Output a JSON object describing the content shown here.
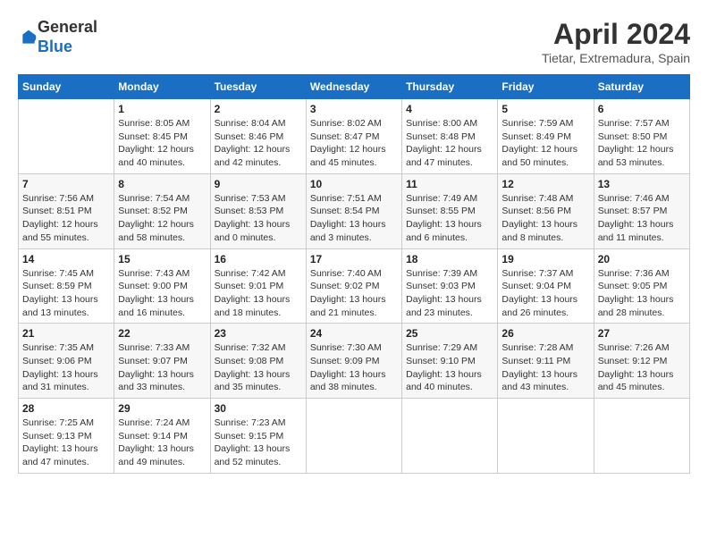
{
  "logo": {
    "general": "General",
    "blue": "Blue"
  },
  "title": "April 2024",
  "location": "Tietar, Extremadura, Spain",
  "days_header": [
    "Sunday",
    "Monday",
    "Tuesday",
    "Wednesday",
    "Thursday",
    "Friday",
    "Saturday"
  ],
  "weeks": [
    [
      {
        "day": "",
        "sunrise": "",
        "sunset": "",
        "daylight": ""
      },
      {
        "day": "1",
        "sunrise": "Sunrise: 8:05 AM",
        "sunset": "Sunset: 8:45 PM",
        "daylight": "Daylight: 12 hours and 40 minutes."
      },
      {
        "day": "2",
        "sunrise": "Sunrise: 8:04 AM",
        "sunset": "Sunset: 8:46 PM",
        "daylight": "Daylight: 12 hours and 42 minutes."
      },
      {
        "day": "3",
        "sunrise": "Sunrise: 8:02 AM",
        "sunset": "Sunset: 8:47 PM",
        "daylight": "Daylight: 12 hours and 45 minutes."
      },
      {
        "day": "4",
        "sunrise": "Sunrise: 8:00 AM",
        "sunset": "Sunset: 8:48 PM",
        "daylight": "Daylight: 12 hours and 47 minutes."
      },
      {
        "day": "5",
        "sunrise": "Sunrise: 7:59 AM",
        "sunset": "Sunset: 8:49 PM",
        "daylight": "Daylight: 12 hours and 50 minutes."
      },
      {
        "day": "6",
        "sunrise": "Sunrise: 7:57 AM",
        "sunset": "Sunset: 8:50 PM",
        "daylight": "Daylight: 12 hours and 53 minutes."
      }
    ],
    [
      {
        "day": "7",
        "sunrise": "Sunrise: 7:56 AM",
        "sunset": "Sunset: 8:51 PM",
        "daylight": "Daylight: 12 hours and 55 minutes."
      },
      {
        "day": "8",
        "sunrise": "Sunrise: 7:54 AM",
        "sunset": "Sunset: 8:52 PM",
        "daylight": "Daylight: 12 hours and 58 minutes."
      },
      {
        "day": "9",
        "sunrise": "Sunrise: 7:53 AM",
        "sunset": "Sunset: 8:53 PM",
        "daylight": "Daylight: 13 hours and 0 minutes."
      },
      {
        "day": "10",
        "sunrise": "Sunrise: 7:51 AM",
        "sunset": "Sunset: 8:54 PM",
        "daylight": "Daylight: 13 hours and 3 minutes."
      },
      {
        "day": "11",
        "sunrise": "Sunrise: 7:49 AM",
        "sunset": "Sunset: 8:55 PM",
        "daylight": "Daylight: 13 hours and 6 minutes."
      },
      {
        "day": "12",
        "sunrise": "Sunrise: 7:48 AM",
        "sunset": "Sunset: 8:56 PM",
        "daylight": "Daylight: 13 hours and 8 minutes."
      },
      {
        "day": "13",
        "sunrise": "Sunrise: 7:46 AM",
        "sunset": "Sunset: 8:57 PM",
        "daylight": "Daylight: 13 hours and 11 minutes."
      }
    ],
    [
      {
        "day": "14",
        "sunrise": "Sunrise: 7:45 AM",
        "sunset": "Sunset: 8:59 PM",
        "daylight": "Daylight: 13 hours and 13 minutes."
      },
      {
        "day": "15",
        "sunrise": "Sunrise: 7:43 AM",
        "sunset": "Sunset: 9:00 PM",
        "daylight": "Daylight: 13 hours and 16 minutes."
      },
      {
        "day": "16",
        "sunrise": "Sunrise: 7:42 AM",
        "sunset": "Sunset: 9:01 PM",
        "daylight": "Daylight: 13 hours and 18 minutes."
      },
      {
        "day": "17",
        "sunrise": "Sunrise: 7:40 AM",
        "sunset": "Sunset: 9:02 PM",
        "daylight": "Daylight: 13 hours and 21 minutes."
      },
      {
        "day": "18",
        "sunrise": "Sunrise: 7:39 AM",
        "sunset": "Sunset: 9:03 PM",
        "daylight": "Daylight: 13 hours and 23 minutes."
      },
      {
        "day": "19",
        "sunrise": "Sunrise: 7:37 AM",
        "sunset": "Sunset: 9:04 PM",
        "daylight": "Daylight: 13 hours and 26 minutes."
      },
      {
        "day": "20",
        "sunrise": "Sunrise: 7:36 AM",
        "sunset": "Sunset: 9:05 PM",
        "daylight": "Daylight: 13 hours and 28 minutes."
      }
    ],
    [
      {
        "day": "21",
        "sunrise": "Sunrise: 7:35 AM",
        "sunset": "Sunset: 9:06 PM",
        "daylight": "Daylight: 13 hours and 31 minutes."
      },
      {
        "day": "22",
        "sunrise": "Sunrise: 7:33 AM",
        "sunset": "Sunset: 9:07 PM",
        "daylight": "Daylight: 13 hours and 33 minutes."
      },
      {
        "day": "23",
        "sunrise": "Sunrise: 7:32 AM",
        "sunset": "Sunset: 9:08 PM",
        "daylight": "Daylight: 13 hours and 35 minutes."
      },
      {
        "day": "24",
        "sunrise": "Sunrise: 7:30 AM",
        "sunset": "Sunset: 9:09 PM",
        "daylight": "Daylight: 13 hours and 38 minutes."
      },
      {
        "day": "25",
        "sunrise": "Sunrise: 7:29 AM",
        "sunset": "Sunset: 9:10 PM",
        "daylight": "Daylight: 13 hours and 40 minutes."
      },
      {
        "day": "26",
        "sunrise": "Sunrise: 7:28 AM",
        "sunset": "Sunset: 9:11 PM",
        "daylight": "Daylight: 13 hours and 43 minutes."
      },
      {
        "day": "27",
        "sunrise": "Sunrise: 7:26 AM",
        "sunset": "Sunset: 9:12 PM",
        "daylight": "Daylight: 13 hours and 45 minutes."
      }
    ],
    [
      {
        "day": "28",
        "sunrise": "Sunrise: 7:25 AM",
        "sunset": "Sunset: 9:13 PM",
        "daylight": "Daylight: 13 hours and 47 minutes."
      },
      {
        "day": "29",
        "sunrise": "Sunrise: 7:24 AM",
        "sunset": "Sunset: 9:14 PM",
        "daylight": "Daylight: 13 hours and 49 minutes."
      },
      {
        "day": "30",
        "sunrise": "Sunrise: 7:23 AM",
        "sunset": "Sunset: 9:15 PM",
        "daylight": "Daylight: 13 hours and 52 minutes."
      },
      {
        "day": "",
        "sunrise": "",
        "sunset": "",
        "daylight": ""
      },
      {
        "day": "",
        "sunrise": "",
        "sunset": "",
        "daylight": ""
      },
      {
        "day": "",
        "sunrise": "",
        "sunset": "",
        "daylight": ""
      },
      {
        "day": "",
        "sunrise": "",
        "sunset": "",
        "daylight": ""
      }
    ]
  ]
}
